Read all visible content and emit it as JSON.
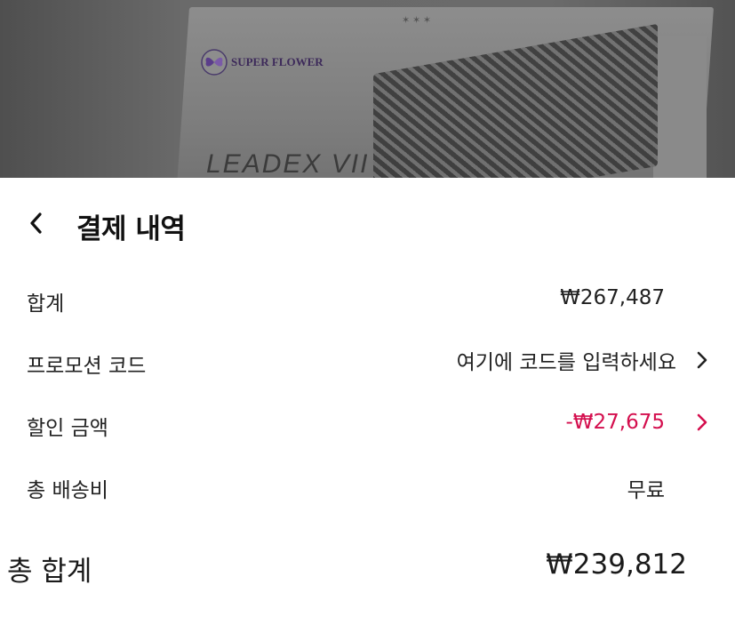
{
  "banner": {
    "brand_logo_text": "SUPER FLOWER",
    "product_name": "LEADEX VII"
  },
  "header": {
    "title": "결제 내역"
  },
  "summary": {
    "subtotal": {
      "label": "합계",
      "value": "₩267,487"
    },
    "promo": {
      "label": "프로모션 코드",
      "placeholder": "여기에 코드를 입력하세요",
      "icon": "chevron-right-icon"
    },
    "discount": {
      "label": "할인 금액",
      "value": "-₩27,675",
      "color": "#d40f4e",
      "icon": "chevron-right-icon"
    },
    "shipping": {
      "label": "총 배송비",
      "value": "무료"
    }
  },
  "total": {
    "label": "총 합계",
    "value": "₩239,812"
  }
}
